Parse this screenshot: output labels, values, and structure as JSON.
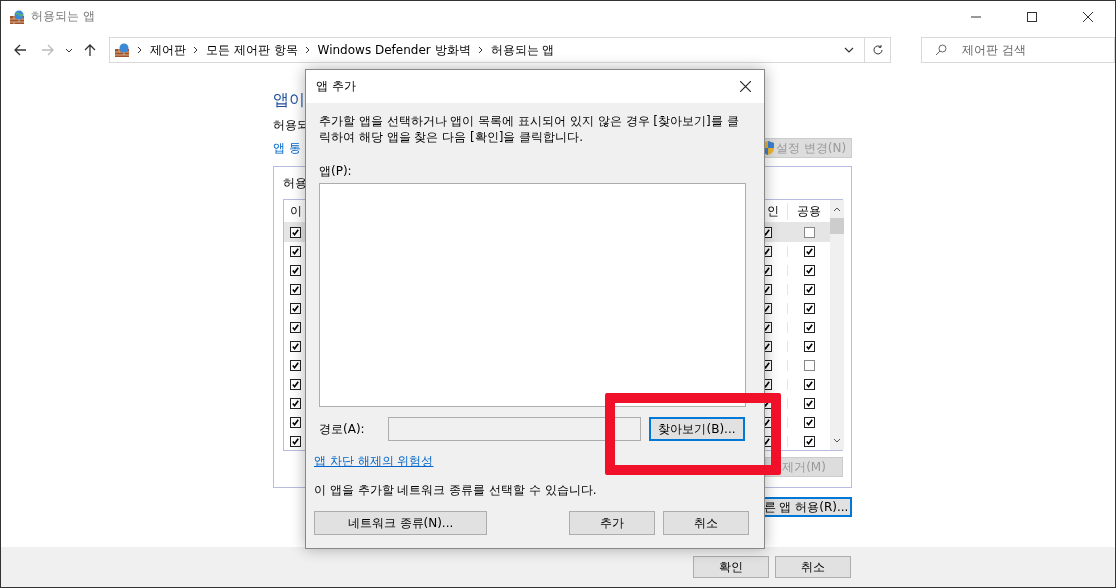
{
  "window": {
    "title": "허용되는 앱"
  },
  "address_bar": {
    "path": [
      "제어판",
      "모든 제어판 항목",
      "Windows Defender 방화벽",
      "허용되는 앱"
    ]
  },
  "search": {
    "placeholder": "제어판 검색"
  },
  "content": {
    "heading": "앱이",
    "description": "허용되",
    "link": "앱 통",
    "change_settings": {
      "label": "설정 변경(N)",
      "disabled": true
    },
    "group_label": "허용",
    "columns": [
      {
        "label": "이"
      },
      {
        "label": "인"
      },
      {
        "label": "공용"
      }
    ],
    "rows": [
      {
        "selected": true,
        "enabled": true,
        "private": true,
        "public": false
      },
      {
        "selected": false,
        "enabled": true,
        "private": true,
        "public": true
      },
      {
        "selected": false,
        "enabled": true,
        "private": true,
        "public": true
      },
      {
        "selected": false,
        "enabled": true,
        "private": true,
        "public": true
      },
      {
        "selected": false,
        "enabled": true,
        "private": true,
        "public": true
      },
      {
        "selected": false,
        "enabled": true,
        "private": true,
        "public": true
      },
      {
        "selected": false,
        "enabled": true,
        "private": true,
        "public": true
      },
      {
        "selected": false,
        "enabled": true,
        "private": true,
        "public": false
      },
      {
        "selected": false,
        "enabled": true,
        "private": true,
        "public": true
      },
      {
        "selected": false,
        "enabled": true,
        "private": true,
        "public": true
      },
      {
        "selected": false,
        "enabled": true,
        "private": true,
        "public": true
      },
      {
        "selected": false,
        "enabled": true,
        "private": true,
        "public": true
      }
    ],
    "remove": {
      "label": "제거(M)",
      "disabled": true
    },
    "allow_other": {
      "label": "른 앱 허용(R)...",
      "disabled": false
    }
  },
  "dialog": {
    "title": "앱 추가",
    "instructions": "추가할 앱을 선택하거나 앱이 목록에 표시되어 있지 않은 경우 [찾아보기]를 클릭하여 해당 앱을 찾은 다음 [확인]을 클릭합니다.",
    "apps_label": "앱(P):",
    "path_label": "경로(A):",
    "browse": "찾아보기(B)...",
    "risk_link": "앱 차단 해제의 위험성",
    "network_note": "이 앱을 추가할 네트워크 종류를 선택할 수 있습니다.",
    "network_types": "네트워크 종류(N)...",
    "add": "추가",
    "cancel": "취소"
  },
  "footer_buttons": [
    {
      "label": "확인"
    },
    {
      "label": "취소"
    }
  ]
}
